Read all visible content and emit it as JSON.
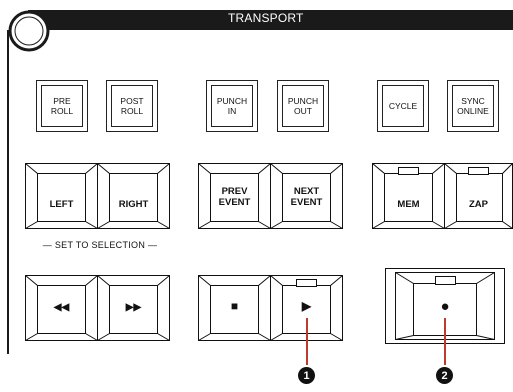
{
  "header": {
    "title": "TRANSPORT"
  },
  "small_buttons": [
    {
      "label": "PRE\nROLL"
    },
    {
      "label": "POST\nROLL"
    },
    {
      "label": "PUNCH\nIN"
    },
    {
      "label": "PUNCH\nOUT"
    },
    {
      "label": "CYCLE"
    },
    {
      "label": "SYNC\nONLINE"
    }
  ],
  "mid_buttons": [
    {
      "label": "LEFT"
    },
    {
      "label": "RIGHT"
    },
    {
      "label": "PREV\nEVENT"
    },
    {
      "label": "NEXT\nEVENT"
    },
    {
      "label": "MEM"
    },
    {
      "label": "ZAP"
    }
  ],
  "set_to_selection": "— SET TO SELECTION —",
  "transport_buttons": [
    {
      "symbol": "◀◀",
      "icon": "rewind-icon"
    },
    {
      "symbol": "▶▶",
      "icon": "fast-forward-icon"
    },
    {
      "symbol": "■",
      "icon": "stop-icon"
    },
    {
      "symbol": "▶",
      "icon": "play-icon"
    },
    {
      "symbol": "●",
      "icon": "record-icon"
    }
  ],
  "callouts": [
    "1",
    "2"
  ],
  "colors": {
    "accent": "#c0392b",
    "frame": "#1a1a1a"
  }
}
